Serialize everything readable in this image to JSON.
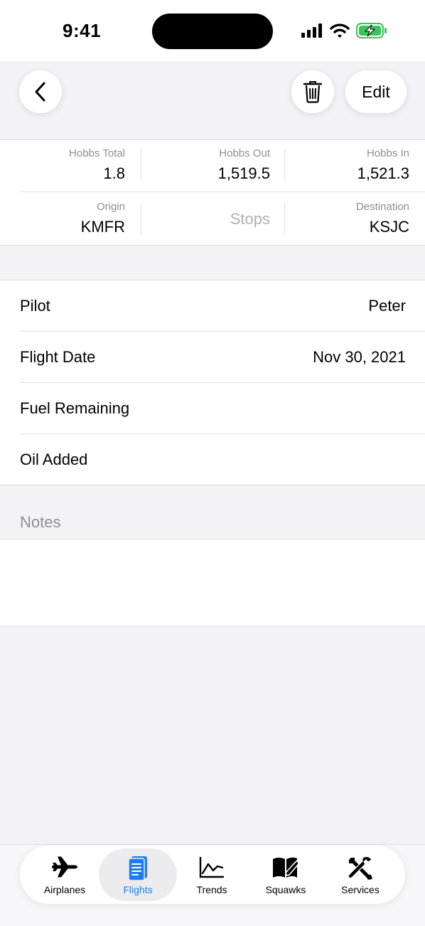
{
  "status_bar": {
    "time": "9:41"
  },
  "nav": {
    "edit_label": "Edit"
  },
  "hobbs": {
    "total_label": "Hobbs Total",
    "total_value": "1.8",
    "out_label": "Hobbs Out",
    "out_value": "1,519.5",
    "in_label": "Hobbs In",
    "in_value": "1,521.3",
    "origin_label": "Origin",
    "origin_value": "KMFR",
    "stops_placeholder": "Stops",
    "destination_label": "Destination",
    "destination_value": "KSJC"
  },
  "details": [
    {
      "label": "Pilot",
      "value": "Peter"
    },
    {
      "label": "Flight Date",
      "value": "Nov 30, 2021"
    },
    {
      "label": "Fuel Remaining",
      "value": ""
    },
    {
      "label": "Oil Added",
      "value": ""
    }
  ],
  "notes": {
    "header": "Notes"
  },
  "tabs": [
    {
      "label": "Airplanes",
      "icon": "airplane-icon"
    },
    {
      "label": "Flights",
      "icon": "logbook-icon",
      "active": true
    },
    {
      "label": "Trends",
      "icon": "chart-icon"
    },
    {
      "label": "Squawks",
      "icon": "book-wrench-icon"
    },
    {
      "label": "Services",
      "icon": "tools-icon"
    }
  ],
  "colors": {
    "accent": "#1e7ef0",
    "battery": "#34c759",
    "background": "#f2f2f7"
  }
}
